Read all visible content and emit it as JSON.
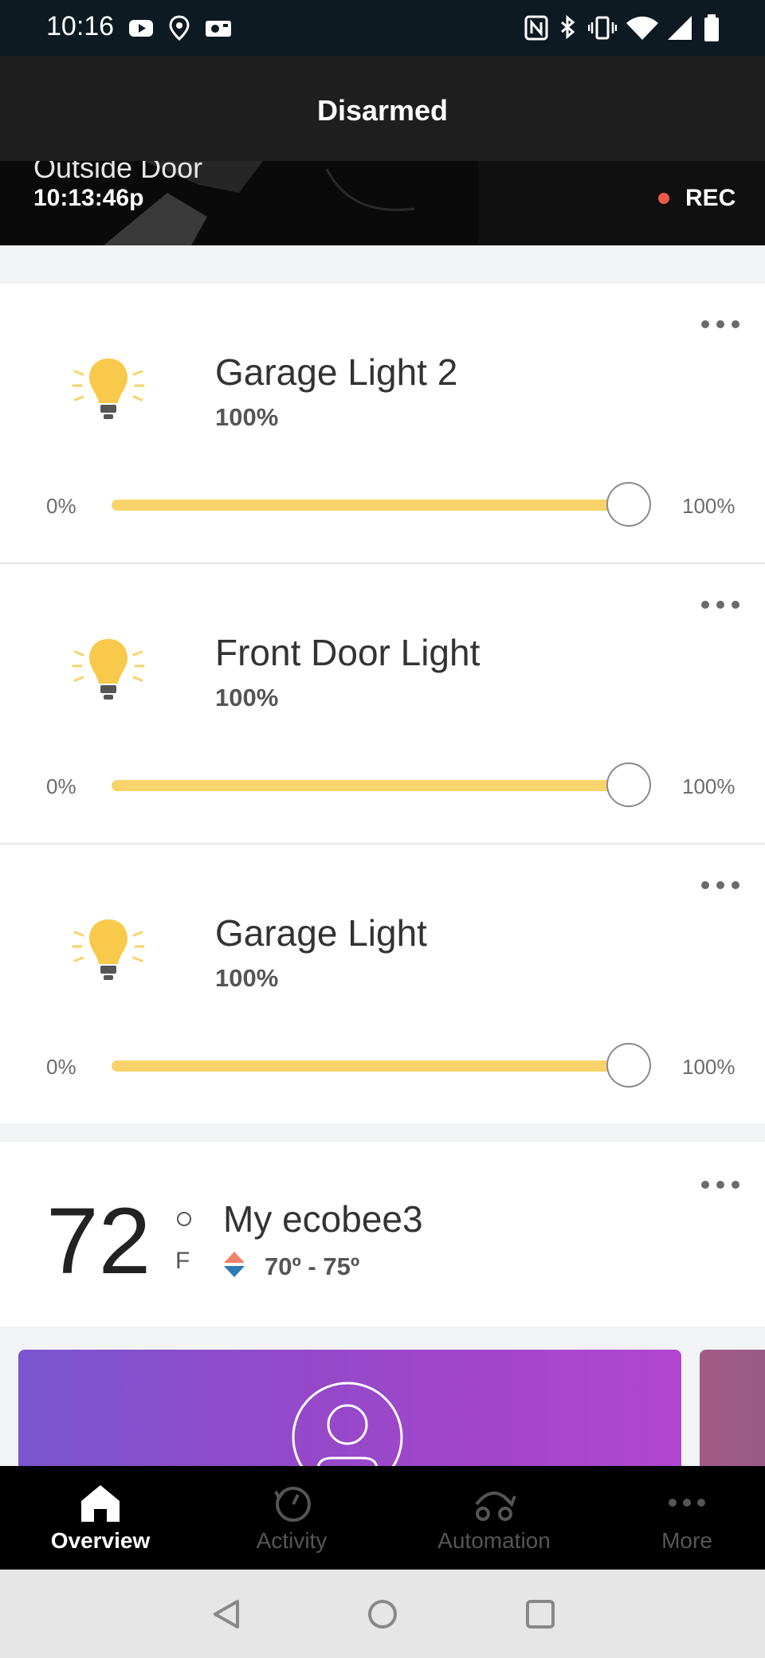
{
  "status_bar": {
    "time": "10:16"
  },
  "header": {
    "title": "Disarmed"
  },
  "camera": {
    "name": "Outside Door",
    "timestamp": "10:13:46p",
    "rec_label": "REC"
  },
  "lights": [
    {
      "name": "Garage Light 2",
      "level": "100%",
      "min_label": "0%",
      "max_label": "100%",
      "value": 1.0
    },
    {
      "name": "Front Door Light",
      "level": "100%",
      "min_label": "0%",
      "max_label": "100%",
      "value": 1.0
    },
    {
      "name": "Garage Light",
      "level": "100%",
      "min_label": "0%",
      "max_label": "100%",
      "value": 1.0
    }
  ],
  "thermostat": {
    "temp": "72",
    "unit": "F",
    "name": "My ecobee3",
    "range": "70º - 75º"
  },
  "bottom_nav": [
    {
      "label": "Overview",
      "icon": "home-icon",
      "active": true
    },
    {
      "label": "Activity",
      "icon": "history-icon",
      "active": false
    },
    {
      "label": "Automation",
      "icon": "automation-icon",
      "active": false
    },
    {
      "label": "More",
      "icon": "more-dots-icon",
      "active": false
    }
  ],
  "colors": {
    "accent_yellow": "#f8d36b",
    "rec_red": "#f05a47",
    "promo_purple": "#9548c9"
  }
}
